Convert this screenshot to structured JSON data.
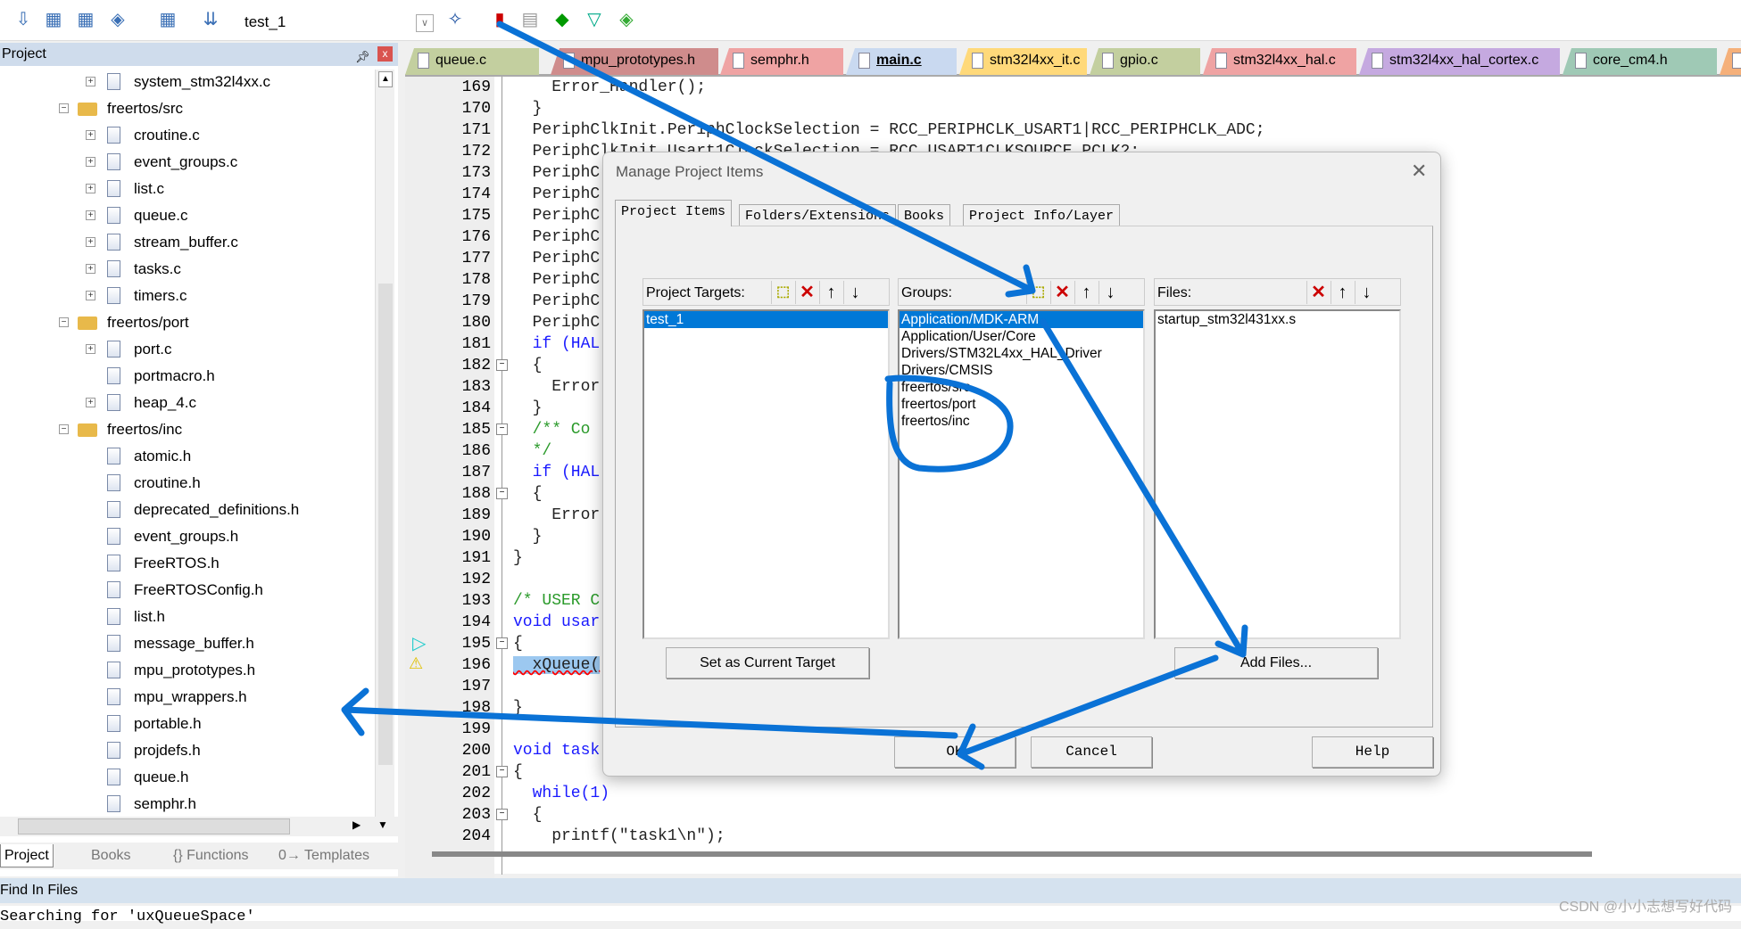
{
  "toolbar": {
    "target": "test_1",
    "icons": [
      "download-icon",
      "build-icon",
      "rebuild-icon",
      "batch-build-icon",
      "stop-build-icon",
      "load-icon",
      "target-options-icon",
      "manage-project-icon",
      "select-packs-icon",
      "pack-installer-icon",
      "manage-runtime-icon",
      "event-recorder-icon"
    ]
  },
  "project_panel": {
    "title": "Project",
    "tree": [
      {
        "label": "system_stm32l4xx.c",
        "type": "file",
        "level": 2,
        "expand": "+"
      },
      {
        "label": "freertos/src",
        "type": "folder",
        "level": 1,
        "expand": "-"
      },
      {
        "label": "croutine.c",
        "type": "file",
        "level": 2,
        "expand": "+"
      },
      {
        "label": "event_groups.c",
        "type": "file",
        "level": 2,
        "expand": "+"
      },
      {
        "label": "list.c",
        "type": "file",
        "level": 2,
        "expand": "+"
      },
      {
        "label": "queue.c",
        "type": "file",
        "level": 2,
        "expand": "+"
      },
      {
        "label": "stream_buffer.c",
        "type": "file",
        "level": 2,
        "expand": "+"
      },
      {
        "label": "tasks.c",
        "type": "file",
        "level": 2,
        "expand": "+"
      },
      {
        "label": "timers.c",
        "type": "file",
        "level": 2,
        "expand": "+"
      },
      {
        "label": "freertos/port",
        "type": "folder",
        "level": 1,
        "expand": "-"
      },
      {
        "label": "port.c",
        "type": "file",
        "level": 2,
        "expand": "+"
      },
      {
        "label": "portmacro.h",
        "type": "file",
        "level": 2,
        "expand": ""
      },
      {
        "label": "heap_4.c",
        "type": "file",
        "level": 2,
        "expand": "+"
      },
      {
        "label": "freertos/inc",
        "type": "folder",
        "level": 1,
        "expand": "-"
      },
      {
        "label": "atomic.h",
        "type": "file",
        "level": 2,
        "expand": ""
      },
      {
        "label": "croutine.h",
        "type": "file",
        "level": 2,
        "expand": ""
      },
      {
        "label": "deprecated_definitions.h",
        "type": "file",
        "level": 2,
        "expand": ""
      },
      {
        "label": "event_groups.h",
        "type": "file",
        "level": 2,
        "expand": ""
      },
      {
        "label": "FreeRTOS.h",
        "type": "file",
        "level": 2,
        "expand": ""
      },
      {
        "label": "FreeRTOSConfig.h",
        "type": "file",
        "level": 2,
        "expand": ""
      },
      {
        "label": "list.h",
        "type": "file",
        "level": 2,
        "expand": ""
      },
      {
        "label": "message_buffer.h",
        "type": "file",
        "level": 2,
        "expand": ""
      },
      {
        "label": "mpu_prototypes.h",
        "type": "file",
        "level": 2,
        "expand": ""
      },
      {
        "label": "mpu_wrappers.h",
        "type": "file",
        "level": 2,
        "expand": ""
      },
      {
        "label": "portable.h",
        "type": "file",
        "level": 2,
        "expand": ""
      },
      {
        "label": "projdefs.h",
        "type": "file",
        "level": 2,
        "expand": ""
      },
      {
        "label": "queue.h",
        "type": "file",
        "level": 2,
        "expand": ""
      },
      {
        "label": "semphr.h",
        "type": "file",
        "level": 2,
        "expand": ""
      }
    ],
    "bottom_tabs": [
      "Project",
      "Books",
      "{} Functions",
      "0→ Templates"
    ]
  },
  "editor": {
    "tabs": [
      {
        "label": "queue.c",
        "color": "#c3cf9f"
      },
      {
        "label": "mpu_prototypes.h",
        "color": "#cf8c8c"
      },
      {
        "label": "semphr.h",
        "color": "#efa3a3"
      },
      {
        "label": "main.c",
        "color": "#c9d9f0",
        "active": true
      },
      {
        "label": "stm32l4xx_it.c",
        "color": "#ffd97a"
      },
      {
        "label": "gpio.c",
        "color": "#c3cf9f"
      },
      {
        "label": "stm32l4xx_hal.c",
        "color": "#efa3a3"
      },
      {
        "label": "stm32l4xx_hal_cortex.c",
        "color": "#c5a9e0"
      },
      {
        "label": "core_cm4.h",
        "color": "#9fc9b5"
      },
      {
        "label": "",
        "color": "#f5b07a"
      }
    ],
    "lines": [
      {
        "n": "169",
        "t": "    Error_Handler();"
      },
      {
        "n": "170",
        "t": "  }"
      },
      {
        "n": "171",
        "t": "  PeriphClkInit.PeriphClockSelection = RCC_PERIPHCLK_USART1|RCC_PERIPHCLK_ADC;"
      },
      {
        "n": "172",
        "t": "  PeriphClkInit.Usart1ClockSelection = RCC_USART1CLKSOURCE_PCLK2;"
      },
      {
        "n": "173",
        "t": "  PeriphC"
      },
      {
        "n": "174",
        "t": "  PeriphC"
      },
      {
        "n": "175",
        "t": "  PeriphC"
      },
      {
        "n": "176",
        "t": "  PeriphC"
      },
      {
        "n": "177",
        "t": "  PeriphC"
      },
      {
        "n": "178",
        "t": "  PeriphC"
      },
      {
        "n": "179",
        "t": "  PeriphC"
      },
      {
        "n": "180",
        "t": "  PeriphC"
      },
      {
        "n": "181",
        "t": "  if (HAL",
        "kw": true,
        "fold": "-"
      },
      {
        "n": "182",
        "t": "  {",
        "fold": "box"
      },
      {
        "n": "183",
        "t": "    Error"
      },
      {
        "n": "184",
        "t": "  }"
      },
      {
        "n": "185",
        "t": "  /** Co",
        "cm": true,
        "fold": "box"
      },
      {
        "n": "186",
        "t": "  */",
        "cm": true
      },
      {
        "n": "187",
        "t": "  if (HAL",
        "kw": true
      },
      {
        "n": "188",
        "t": "  {",
        "fold": "box"
      },
      {
        "n": "189",
        "t": "    Error"
      },
      {
        "n": "190",
        "t": "  }"
      },
      {
        "n": "191",
        "t": "}"
      },
      {
        "n": "192",
        "t": ""
      },
      {
        "n": "193",
        "t": "/* USER C",
        "cm": true
      },
      {
        "n": "194",
        "t": "void usar",
        "kw": true
      },
      {
        "n": "195",
        "t": "{",
        "fold": "box",
        "marker": "arrow"
      },
      {
        "n": "196",
        "t": "  xQueue(",
        "hl": true,
        "marker": "warning"
      },
      {
        "n": "197",
        "t": ""
      },
      {
        "n": "198",
        "t": "}"
      },
      {
        "n": "199",
        "t": ""
      },
      {
        "n": "200",
        "t": "void task",
        "kw": true
      },
      {
        "n": "201",
        "t": "{",
        "fold": "box"
      },
      {
        "n": "202",
        "t": "  while(1)",
        "kw": true
      },
      {
        "n": "203",
        "t": "  {",
        "fold": "box"
      },
      {
        "n": "204",
        "t": "    printf(\"task1\\n\");"
      }
    ]
  },
  "find": {
    "title": "Find In Files",
    "output": "Searching for 'uxQueueSpace'"
  },
  "dialog": {
    "title": "Manage Project Items",
    "tabs": [
      "Project Items",
      "Folders/Extensions",
      "Books",
      "Project Info/Layer"
    ],
    "targets": {
      "label": "Project Targets:",
      "items": [
        "test_1"
      ],
      "selected": 0
    },
    "groups": {
      "label": "Groups:",
      "items": [
        "Application/MDK-ARM",
        "Application/User/Core",
        "Drivers/STM32L4xx_HAL_Driver",
        "Drivers/CMSIS",
        "freertos/src",
        "freertos/port",
        "freertos/inc"
      ],
      "selected": 0
    },
    "files": {
      "label": "Files:",
      "items": [
        "startup_stm32l431xx.s"
      ]
    },
    "buttons": {
      "set_target": "Set as Current Target",
      "add_files": "Add Files...",
      "ok": "OK",
      "cancel": "Cancel",
      "help": "Help"
    }
  },
  "annotation_color": "#0a72d6",
  "watermark": "CSDN @小小志想写好代码"
}
